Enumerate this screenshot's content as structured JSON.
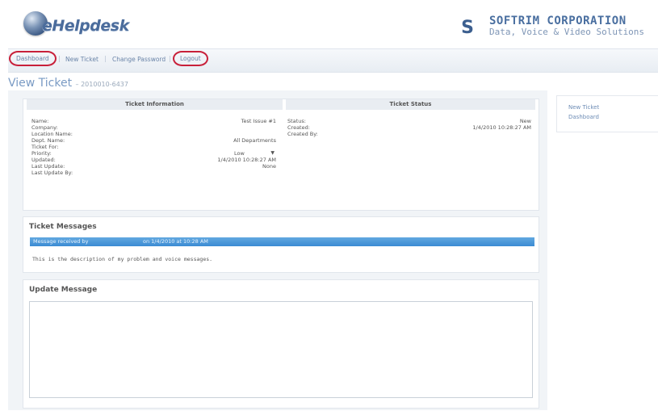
{
  "app": {
    "logo_text": "eHelpdesk"
  },
  "brand": {
    "mark": "S",
    "name": "SOFTRIM CORPORATION",
    "tagline": "Data, Voice & Video Solutions",
    "accent_color": "#4a6fa0",
    "highlight_color": "#c8203a"
  },
  "nav": {
    "items": [
      {
        "label": "Dashboard",
        "circled": true
      },
      {
        "label": "New Ticket",
        "circled": false
      },
      {
        "label": "Change Password",
        "circled": false
      },
      {
        "label": "Logout",
        "circled": true
      }
    ],
    "separator": "|"
  },
  "page": {
    "title": "View Ticket",
    "subtitle": "– 2010010-6437"
  },
  "ticket_info": {
    "header": "Ticket Information",
    "fields": [
      {
        "label": "Name:",
        "value": "Test Issue #1"
      },
      {
        "label": "Company:",
        "value": ""
      },
      {
        "label": "Location Name:",
        "value": ""
      },
      {
        "label": "Dept. Name:",
        "value": "All Departments"
      },
      {
        "label": "Ticket For:",
        "value": ""
      },
      {
        "label": "Priority:",
        "value": "Low"
      },
      {
        "label": "Updated:",
        "value": "1/4/2010 10:28:27 AM"
      },
      {
        "label": "Last Update:",
        "value": "None"
      },
      {
        "label": "Last Update By:",
        "value": ""
      }
    ]
  },
  "ticket_status": {
    "header": "Ticket Status",
    "fields": [
      {
        "label": "Status:",
        "value": "New"
      },
      {
        "label": "Created:",
        "value": "1/4/2010 10:28:27 AM"
      },
      {
        "label": "Created By:",
        "value": ""
      }
    ]
  },
  "messages": {
    "title": "Ticket Messages",
    "header_from": "Message received by",
    "header_date": "on 1/4/2010 at 10:28 AM",
    "body": "This is the description of my problem and voice messages."
  },
  "update": {
    "title": "Update Message",
    "value": ""
  },
  "sidebar": {
    "links": [
      "New Ticket",
      "Dashboard"
    ]
  }
}
